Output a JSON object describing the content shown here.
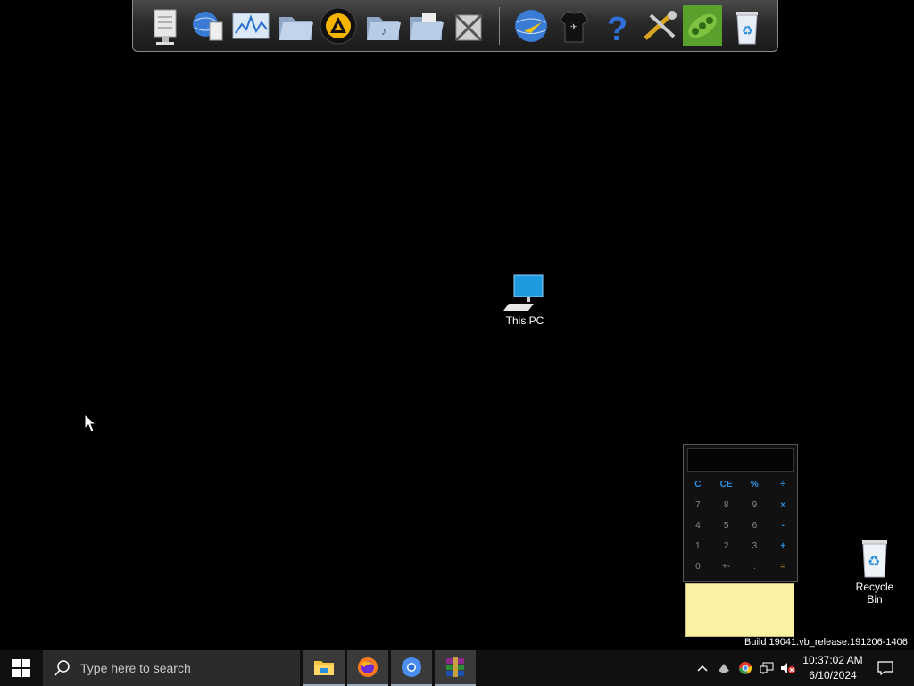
{
  "dock": {
    "icons": [
      "notepad-icon",
      "globe-document-icon",
      "monitor-chart-icon",
      "folder-open-icon",
      "aimp-icon",
      "folder-music-icon",
      "folder-files-icon",
      "tools-icon",
      "internet-globe-icon",
      "tshirt-icon",
      "help-icon",
      "settings-tools-icon",
      "pea-icon",
      "recycle-bin-icon"
    ]
  },
  "desktop": {
    "this_pc_label": "This PC",
    "recycle_bin_label": "Recycle\nBin"
  },
  "calculator": {
    "keys": [
      "C",
      "CE",
      "%",
      "÷",
      "7",
      "8",
      "9",
      "x",
      "4",
      "5",
      "6",
      "-",
      "1",
      "2",
      "3",
      "+",
      "0",
      "+-",
      ".",
      "="
    ]
  },
  "watermark": "Build 19041.vb_release.191206-1406",
  "taskbar": {
    "search_placeholder": "Type here to search",
    "apps": [
      "file-explorer-icon",
      "firefox-icon",
      "chromium-icon",
      "winrar-icon"
    ],
    "clock_time": "10:37:02 AM",
    "clock_date": "6/10/2024"
  },
  "colors": {
    "accent_blue": "#2a8fe0",
    "sticky_yellow": "#fbf1a4",
    "taskbar": "#101010"
  }
}
